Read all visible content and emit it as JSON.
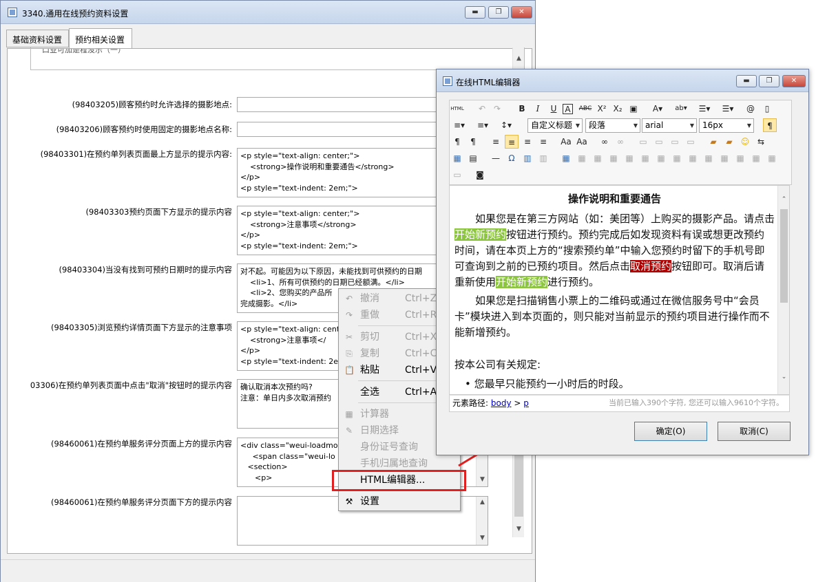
{
  "main_window": {
    "title": "3340.通用在线预约资料设置",
    "controls": {
      "minimize": "▬",
      "maximize": "❐",
      "close": "✕"
    },
    "tabs": [
      "基础资料设置",
      "预约相关设置"
    ],
    "active_tab": "预约相关设置",
    "top_cut_text": "口业可加是程没示（一）",
    "fields": [
      {
        "label": "(98403205)顾客预约时允许选择的摄影地点:",
        "value": ""
      },
      {
        "label": "(98403206)顾客预约时使用固定的摄影地点名称:",
        "value": ""
      },
      {
        "label": "(98403301)在预约单列表页面最上方显示的提示内容:",
        "value": "<p style=\"text-align: center;\">\n    <strong>操作说明和重要通告</strong>\n</p>\n<p style=\"text-indent: 2em;\">"
      },
      {
        "label": "(98403303预约页面下方显示的提示内容",
        "value": "<p style=\"text-align: center;\">\n    <strong>注意事项</strong>\n</p>\n<p style=\"text-indent: 2em;\">"
      },
      {
        "label": "(98403304)当没有找到可预约日期时的提示内容",
        "value": "对不起。可能因为以下原因，未能找到可供预约的日期\n    <li>1、所有可供预约的日期已经额满。</li>\n    <li>2、您购买的产品所\n完成摄影。</li>"
      },
      {
        "label": "(98403305)浏览预约详情页面下方显示的注意事项",
        "value": "<p style=\"text-align: center\n    <strong>注意事项</\n</p>\n<p style=\"text-indent: 2em;"
      },
      {
        "label": "03306)在预约单列表页面中点击\"取消\"按钮时的提示内容",
        "value": "确认取消本次预约吗?\n注意：单日内多次取消预约"
      },
      {
        "label": "(98460061)在预约单服务评分页面上方的提示内容",
        "value": "<div class=\"weui-loadmor\n     <span class=\"weui-lo\n   <section>\n      <p>"
      },
      {
        "label": "(98460061)在预约单服务评分页面下方的提示内容",
        "value": ""
      }
    ]
  },
  "context_menu": {
    "items": [
      {
        "icon": "undo-icon",
        "glyph": "↶",
        "label": "撤消",
        "shortcut": "Ctrl+Z",
        "enabled": false
      },
      {
        "icon": "redo-icon",
        "glyph": "↷",
        "label": "重做",
        "shortcut": "Ctrl+R",
        "enabled": false
      },
      {
        "icon": "cut-icon",
        "glyph": "✂",
        "label": "剪切",
        "shortcut": "Ctrl+X",
        "enabled": false
      },
      {
        "icon": "copy-icon",
        "glyph": "⎘",
        "label": "复制",
        "shortcut": "Ctrl+C",
        "enabled": false
      },
      {
        "icon": "paste-icon",
        "glyph": "📋",
        "label": "粘贴",
        "shortcut": "Ctrl+V",
        "enabled": true
      },
      {
        "icon": "",
        "glyph": "",
        "label": "全选",
        "shortcut": "Ctrl+A",
        "enabled": true
      },
      {
        "icon": "calculator-icon",
        "glyph": "▦",
        "label": "计算器",
        "shortcut": "",
        "enabled": false
      },
      {
        "icon": "date-icon",
        "glyph": "✎",
        "label": "日期选择",
        "shortcut": "",
        "enabled": false
      },
      {
        "icon": "",
        "glyph": "",
        "label": "身份证号查询",
        "shortcut": "",
        "enabled": false
      },
      {
        "icon": "",
        "glyph": "",
        "label": "手机归属地查询",
        "shortcut": "",
        "enabled": false
      },
      {
        "icon": "",
        "glyph": "",
        "label": "HTML编辑器...",
        "shortcut": "",
        "enabled": true
      },
      {
        "icon": "settings-icon",
        "glyph": "⚒",
        "label": "设置",
        "shortcut": "",
        "enabled": true
      }
    ]
  },
  "editor_window": {
    "title": "在线HTML编辑器",
    "controls": {
      "minimize": "▬",
      "maximize": "❐",
      "close": "✕"
    },
    "toolbar": {
      "source_label": "HTML",
      "heading_select": "自定义标题",
      "paragraph_select": "段落",
      "font_select": "arial",
      "size_select": "16px"
    },
    "content": {
      "heading": "操作说明和重要通告",
      "p1_a": "如果您是在第三方网站（如：美团等）上购买的摄影产品。请点击",
      "p1_hl1": "开始新预约",
      "p1_b": "按钮进行预约。预约完成后如发现资料有误或想更改预约时间，请在本页上方的“搜索预约单”中输入您预约时留下的手机号即可查询到之前的已预约项目。然后点击",
      "p1_hl2": "取消预约",
      "p1_c": "按钮即可。取消后请重新使用",
      "p1_hl3": "开始新预约",
      "p1_d": "进行预约。",
      "p2": "如果您是扫描销售小票上的二维码或通过在微信服务号中“会员卡”模块进入到本页面的，则只能对当前显示的预约项目进行操作而不能新增预约。",
      "p3": "按本公司有关规定:",
      "bullet1": "您最早只能预约一小时后的时段。"
    },
    "element_path_label": "元素路径:",
    "path_body": "body",
    "path_sep": ">",
    "path_p": "p",
    "char_count": "当前已输入390个字符, 您还可以输入9610个字符。",
    "ok_button": "确定(O)",
    "cancel_button": "取消(C)"
  }
}
